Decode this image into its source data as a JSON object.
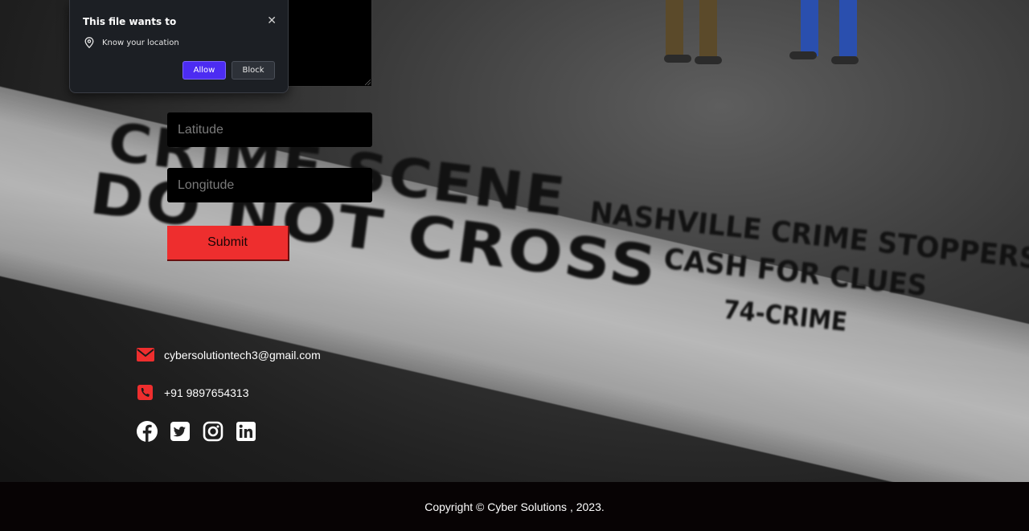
{
  "background": {
    "tape_lines": [
      "CRIME SCENE",
      "DO NOT CROSS",
      "NASHVILLE CRIME STOPPERS",
      "CASH FOR CLUES",
      "74-CRIME"
    ]
  },
  "form": {
    "latitude_placeholder": "Latitude",
    "longitude_placeholder": "Longitude",
    "submit_label": "Submit"
  },
  "contact": {
    "email": "cybersolutiontech3@gmail.com",
    "phone": "+91 9897654313",
    "email_icon": "envelope-icon",
    "phone_icon": "phone-icon",
    "socials": [
      "facebook-icon",
      "twitter-icon",
      "instagram-icon",
      "linkedin-icon"
    ],
    "accent_color": "#ee2e2e"
  },
  "footer": {
    "copyright": "Copyright © Cyber Solutions , 2023."
  },
  "permission_popup": {
    "title": "This file wants to",
    "permission": "Know your location",
    "allow_label": "Allow",
    "block_label": "Block",
    "allow_color": "#4c2cf2"
  }
}
